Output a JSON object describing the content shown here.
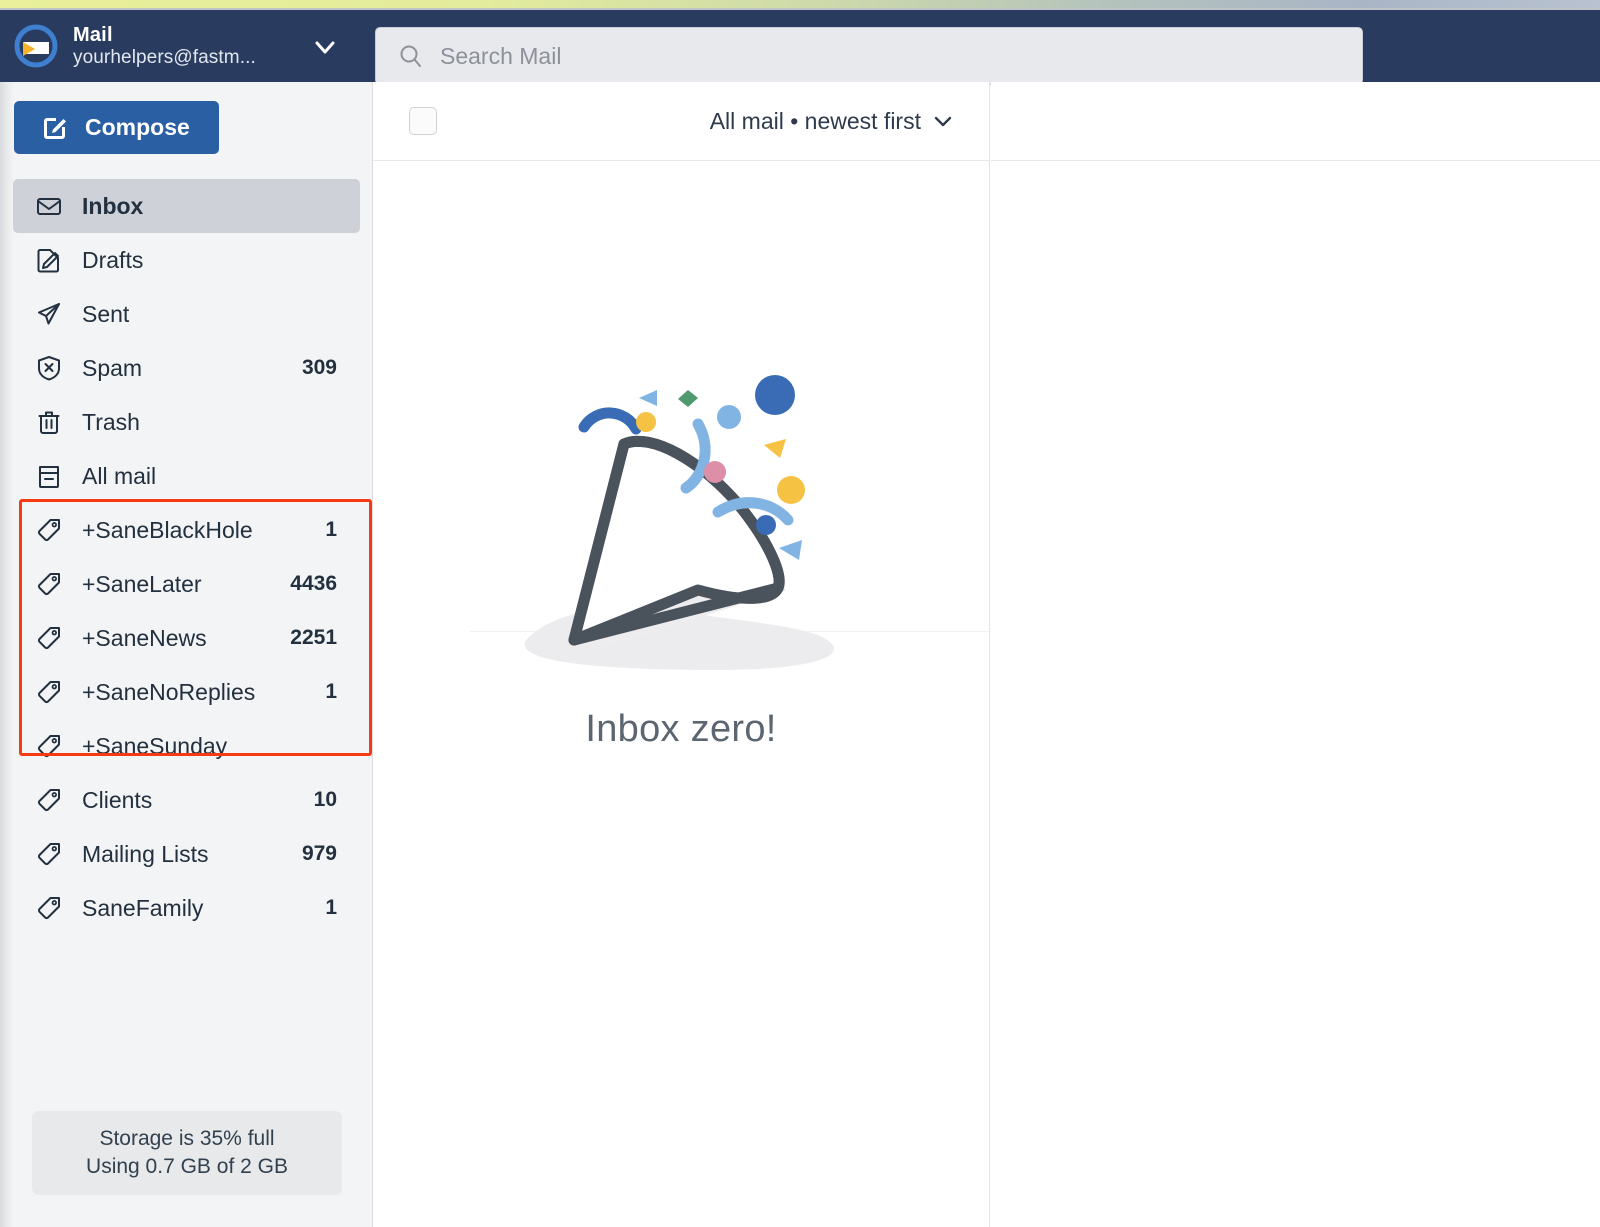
{
  "window": {
    "top_strip_left_color": "#e9ef9a",
    "top_strip_right_color": "#b8c2d0"
  },
  "header": {
    "brand_title": "Mail",
    "brand_email": "yourhelpers@fastm...",
    "brand_icon": "fastmail-envelope-logo",
    "account_chevron_icon": "chevron-down-icon",
    "background_color": "#293b5e"
  },
  "search": {
    "placeholder": "Search Mail",
    "value": "",
    "icon": "search-icon"
  },
  "sidebar": {
    "compose": {
      "label": "Compose",
      "icon": "compose-pencil-icon",
      "color": "#2a5fa3"
    },
    "items": [
      {
        "label": "Inbox",
        "count": "",
        "icon": "inbox-icon",
        "active": true
      },
      {
        "label": "Drafts",
        "count": "",
        "icon": "draft-icon",
        "active": false
      },
      {
        "label": "Sent",
        "count": "",
        "icon": "sent-icon",
        "active": false
      },
      {
        "label": "Spam",
        "count": "309",
        "icon": "spam-shield-icon",
        "active": false
      },
      {
        "label": "Trash",
        "count": "",
        "icon": "trash-icon",
        "active": false
      },
      {
        "label": "All mail",
        "count": "",
        "icon": "archive-icon",
        "active": false
      },
      {
        "label": "+SaneBlackHole",
        "count": "1",
        "icon": "tag-icon",
        "active": false
      },
      {
        "label": "+SaneLater",
        "count": "4436",
        "icon": "tag-icon",
        "active": false
      },
      {
        "label": "+SaneNews",
        "count": "2251",
        "icon": "tag-icon",
        "active": false
      },
      {
        "label": "+SaneNoReplies",
        "count": "1",
        "icon": "tag-icon",
        "active": false
      },
      {
        "label": "+SaneSunday",
        "count": "",
        "icon": "tag-icon",
        "active": false
      },
      {
        "label": "Clients",
        "count": "10",
        "icon": "tag-icon",
        "active": false
      },
      {
        "label": "Mailing Lists",
        "count": "979",
        "icon": "tag-icon",
        "active": false
      },
      {
        "label": "SaneFamily",
        "count": "1",
        "icon": "tag-icon",
        "active": false
      }
    ],
    "highlight": {
      "color": "#f63a13",
      "first_item": "+SaneBlackHole",
      "last_item": "+SaneSunday"
    },
    "storage": {
      "line1": "Storage is 35% full",
      "line2": "Using 0.7 GB of 2 GB",
      "percent": "35"
    }
  },
  "list": {
    "select_all_checked": false,
    "sort_label": "All mail • newest first",
    "sort_chevron_icon": "chevron-down-icon",
    "empty_title": "Inbox zero!",
    "empty_illustration": "party-popper-confetti-illustration"
  },
  "palette": {
    "confetti_dark_blue": "#3a6cb5",
    "confetti_light_blue": "#82b4e3",
    "confetti_yellow": "#f5c243",
    "confetti_pink": "#dd8fa8",
    "confetti_green": "#4f9a6e",
    "cone_stroke": "#4a525c",
    "shadow_gray": "#ececee"
  }
}
